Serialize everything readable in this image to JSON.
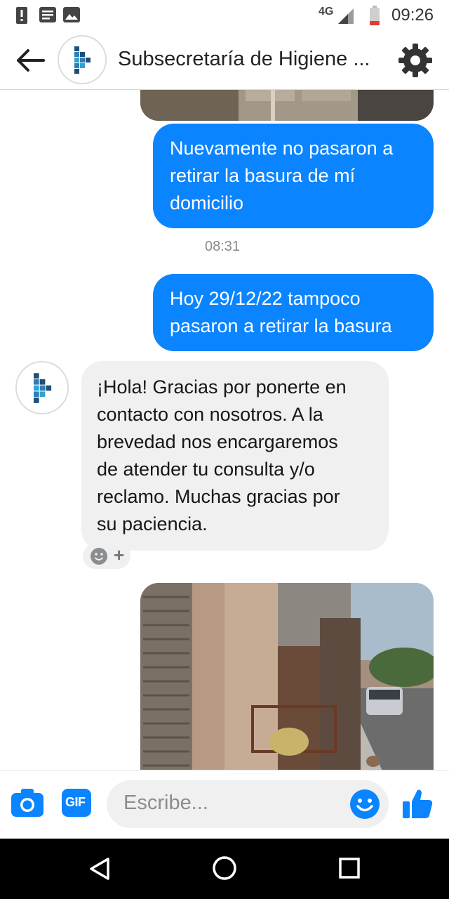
{
  "status_bar": {
    "network": "4G",
    "time": "09:26"
  },
  "header": {
    "title": "Subsecretaría de Higiene ...",
    "back_icon": "arrow-left-icon",
    "settings_icon": "gear-icon"
  },
  "messages": {
    "out_1": "Nuevamente no pasaron a\nretirar la basura de mí\ndomicilio",
    "timestamp": "08:31",
    "out_2": "Hoy 29/12/22 tampoco\npasaron a retirar la basura",
    "in_1": "¡Hola! Gracias por ponerte en\ncontacto con nosotros. A la\nbrevedad nos encargaremos\nde atender tu consulta y/o\nreclamo. Muchas gracias por\nsu paciencia.",
    "reaction_add": "+"
  },
  "composer": {
    "placeholder": "Escribe...",
    "gif_label": "GIF",
    "icons": [
      "camera-icon",
      "gif-icon",
      "emoji-icon",
      "thumbs-up-icon"
    ]
  },
  "colors": {
    "accent": "#0a84ff",
    "incoming_bubble": "#f0f0f0"
  }
}
